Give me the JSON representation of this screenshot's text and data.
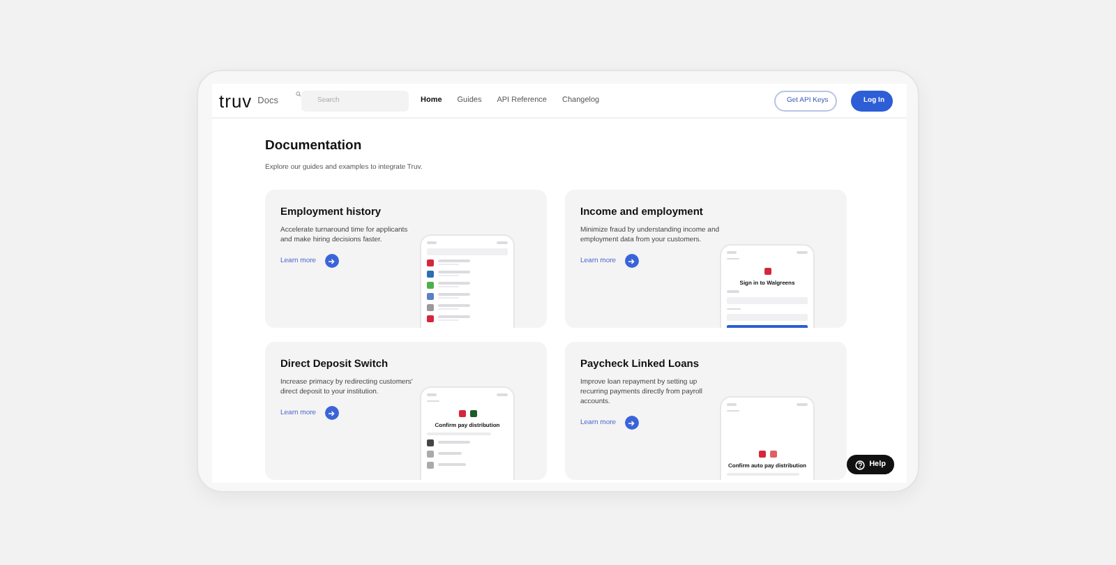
{
  "header": {
    "logo": "truv",
    "product": "Docs",
    "search": {
      "placeholder": "Search"
    },
    "nav": [
      {
        "label": "Home",
        "selected": true
      },
      {
        "label": "Guides",
        "selected": false
      },
      {
        "label": "API Reference",
        "selected": false
      },
      {
        "label": "Changelog",
        "selected": false
      }
    ],
    "buttons": [
      {
        "label": "Get API Keys",
        "kind": "outline"
      },
      {
        "label": "Log In",
        "kind": "primary"
      }
    ]
  },
  "page": {
    "title": "Documentation",
    "subtitle": "Explore our guides and examples to integrate Truv."
  },
  "cards": [
    {
      "title": "Employment history",
      "description": "Accelerate turnaround time for applicants and make hiring decisions faster.",
      "link": "Learn more",
      "preview": {
        "kind": "list"
      }
    },
    {
      "title": "Income and employment",
      "description": "Minimize fraud by understanding income and employment data from your customers.",
      "link": "Learn more",
      "preview": {
        "kind": "signin",
        "heading": "Sign in to Walgreens"
      }
    },
    {
      "title": "Direct Deposit Switch",
      "description": "Increase primacy by redirecting customers' direct deposit to your institution.",
      "link": "Learn more",
      "preview": {
        "kind": "confirm",
        "heading": "Confirm pay distribution"
      }
    },
    {
      "title": "Paycheck Linked Loans",
      "description": "Improve loan repayment by setting up recurring payments directly from payroll accounts.",
      "link": "Learn more",
      "preview": {
        "kind": "autopay",
        "heading": "Confirm auto pay distribution"
      }
    }
  ],
  "help": {
    "label": "Help"
  }
}
